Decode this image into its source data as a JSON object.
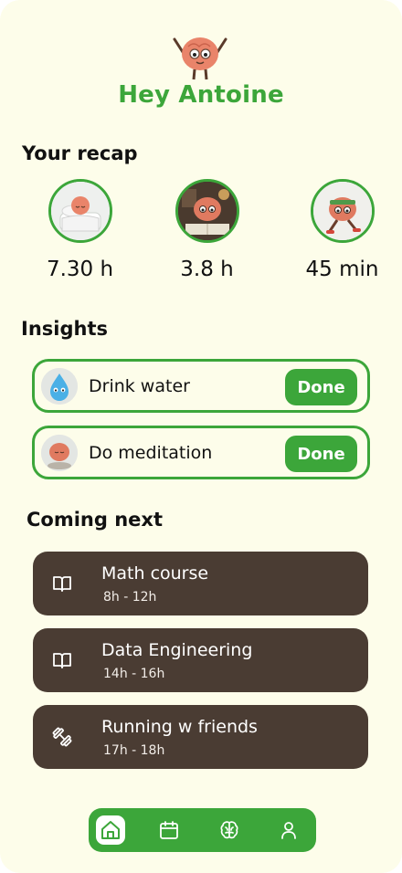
{
  "header": {
    "greeting": "Hey Antoine"
  },
  "recap": {
    "title": "Your recap",
    "items": [
      {
        "icon": "sleep-brain-icon",
        "value": "7.30 h"
      },
      {
        "icon": "study-brain-icon",
        "value": "3.8 h"
      },
      {
        "icon": "running-brain-icon",
        "value": "45 min"
      }
    ]
  },
  "insights": {
    "title": "Insights",
    "items": [
      {
        "icon": "water-drop-icon",
        "label": "Drink water",
        "button": "Done"
      },
      {
        "icon": "meditation-brain-icon",
        "label": "Do meditation",
        "button": "Done"
      }
    ]
  },
  "coming_next": {
    "title": "Coming next",
    "items": [
      {
        "icon": "book-icon",
        "title": "Math course",
        "time": "8h - 12h"
      },
      {
        "icon": "book-icon",
        "title": "Data Engineering",
        "time": "14h - 16h"
      },
      {
        "icon": "dumbbell-icon",
        "title": "Running w friends",
        "time": "17h - 18h"
      }
    ]
  },
  "nav": {
    "items": [
      {
        "icon": "home-icon",
        "active": true
      },
      {
        "icon": "calendar-icon",
        "active": false
      },
      {
        "icon": "brain-icon",
        "active": false
      },
      {
        "icon": "profile-icon",
        "active": false
      }
    ]
  },
  "colors": {
    "background": "#fdfdea",
    "accent": "#3ca63a",
    "card": "#4a3c33"
  }
}
